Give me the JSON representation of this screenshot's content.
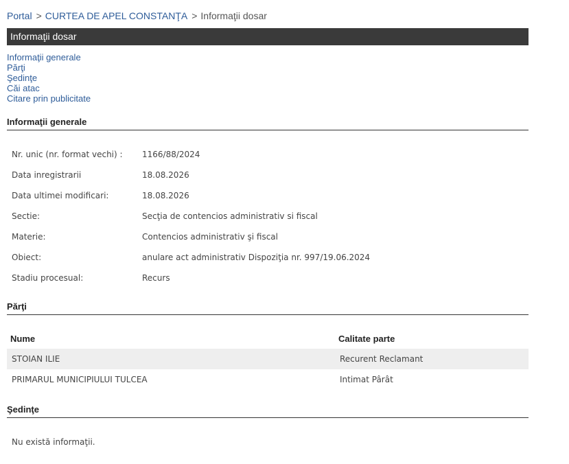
{
  "breadcrumb": {
    "portal": "Portal",
    "sep": ">",
    "court": "CURTEA DE APEL CONSTANŢA",
    "current": "Informaţii dosar"
  },
  "title": "Informaţii dosar",
  "toc": {
    "general": "Informaţii generale",
    "parti": "Părţi",
    "sedinte": "Şedinţe",
    "cai_atac": "Căi atac",
    "citare": "Citare prin publicitate"
  },
  "general": {
    "heading": "Informaţii generale",
    "rows": [
      {
        "label": "Nr. unic (nr. format vechi) :",
        "value": "1166/88/2024"
      },
      {
        "label": "Data inregistrarii",
        "value": "18.08.2026"
      },
      {
        "label": "Data ultimei modificari:",
        "value": "18.08.2026"
      },
      {
        "label": "Sectie:",
        "value": "Secţia de contencios administrativ si fiscal"
      },
      {
        "label": "Materie:",
        "value": "Contencios administrativ şi fiscal"
      },
      {
        "label": "Obiect:",
        "value": "anulare act administrativ Dispoziţia nr. 997/19.06.2024"
      },
      {
        "label": "Stadiu procesual:",
        "value": "Recurs"
      }
    ]
  },
  "parti": {
    "heading": "Părţi",
    "columns": {
      "nume": "Nume",
      "calitate": "Calitate parte"
    },
    "rows": [
      {
        "nume": "STOIAN ILIE",
        "calitate": "Recurent Reclamant"
      },
      {
        "nume": "PRIMARUL MUNICIPIULUI TULCEA",
        "calitate": "Intimat Pârât"
      }
    ]
  },
  "sedinte": {
    "heading": "Şedinţe",
    "empty": "Nu există informaţii."
  }
}
